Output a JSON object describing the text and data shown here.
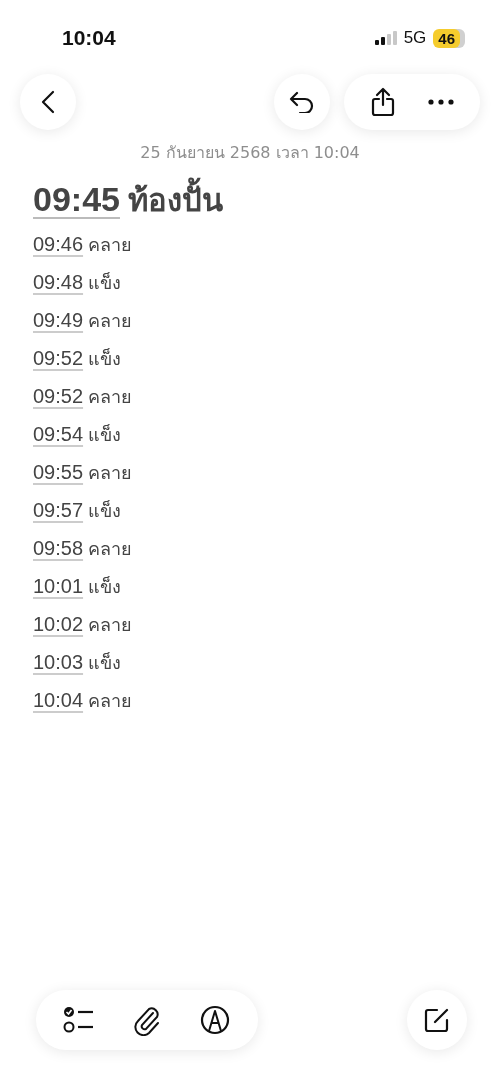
{
  "status_bar": {
    "time": "10:04",
    "network": "5G",
    "battery": "46"
  },
  "note": {
    "date": "25 กันยายน 2568 เวลา 10:04",
    "title": {
      "time": "09:45",
      "text": "ท้องปั้น"
    },
    "lines": [
      {
        "time": "09:46",
        "text": "คลาย"
      },
      {
        "time": "09:48",
        "text": "แข็ง"
      },
      {
        "time": "09:49",
        "text": "คลาย"
      },
      {
        "time": "09:52",
        "text": "แข็ง"
      },
      {
        "time": "09:52",
        "text": "คลาย"
      },
      {
        "time": "09:54",
        "text": "แข็ง"
      },
      {
        "time": "09:55",
        "text": "คลาย"
      },
      {
        "time": "09:57",
        "text": "แข็ง"
      },
      {
        "time": "09:58",
        "text": "คลาย"
      },
      {
        "time": "10:01",
        "text": "แข็ง"
      },
      {
        "time": "10:02",
        "text": "คลาย"
      },
      {
        "time": "10:03",
        "text": "แข็ง"
      },
      {
        "time": "10:04",
        "text": "คลาย"
      }
    ]
  }
}
